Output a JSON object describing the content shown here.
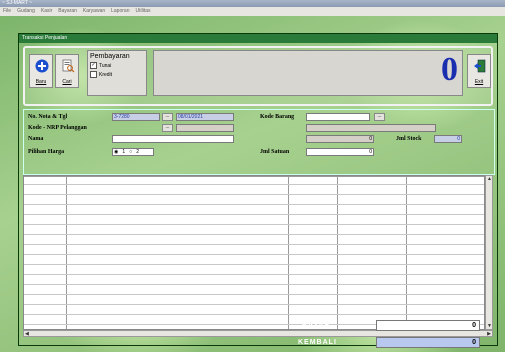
{
  "app": {
    "title": "~ SJ-MART ~"
  },
  "menu": [
    "File",
    "Gudang",
    "Kasir",
    "Bayaran",
    "Karyawan",
    "Laporan",
    "Utilitas"
  ],
  "window": {
    "title": "Transaksi Penjualan"
  },
  "toolbar": {
    "new_label": "Baru",
    "search_label": "Cari",
    "exit_label": "Exit"
  },
  "payment": {
    "title": "Pembayaran",
    "options": [
      {
        "label": "Tunai",
        "checked": true
      },
      {
        "label": "Kredit",
        "checked": false
      }
    ]
  },
  "total": {
    "value": "0"
  },
  "form": {
    "nota_label": "No. Nota & Tgl",
    "nota_value": "3-7280",
    "date_value": "08/01/2021",
    "kode_label": "Kode - NRP Pelanggan",
    "nama_label": "Nama",
    "pilihan_label": "Pilihan Harga",
    "pilihan_options": [
      "1",
      "2"
    ],
    "kode_barang_label": "Kode Barang",
    "qty_value": "0",
    "stock_label": "Jml Stock",
    "stock_value": "0",
    "satuan_label": "Jml Satuan",
    "satuan_value": "0"
  },
  "summary": {
    "bayar_label": "BAYAR",
    "bayar_value": "0",
    "kembali_label": "KEMBALI",
    "kembali_value": "0"
  },
  "colors": {
    "total_value": "#1a2fb0",
    "kembali_fill": "#b9c8ee"
  }
}
